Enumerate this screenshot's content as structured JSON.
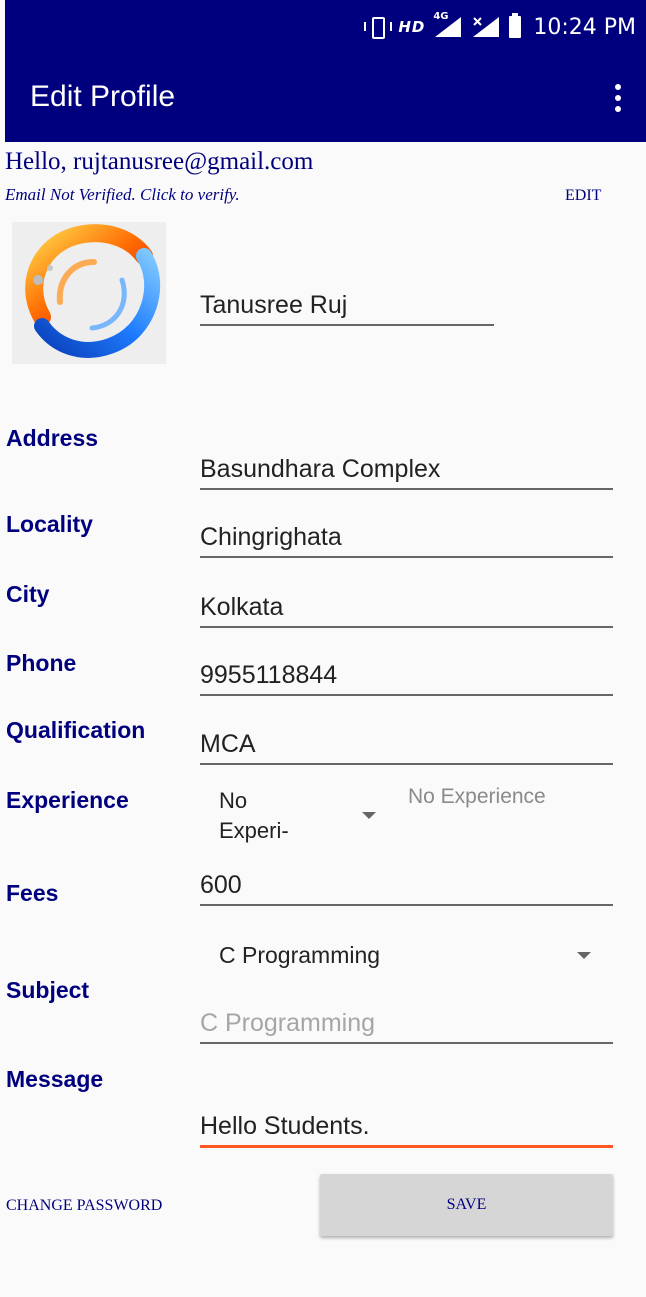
{
  "status_bar": {
    "network_type": "HD",
    "network_gen": "4G",
    "time": "10:24 PM"
  },
  "app_bar": {
    "title": "Edit Profile",
    "menu_icon": "overflow-menu-icon"
  },
  "account": {
    "greeting": "Hello, rujtanusree@gmail.com",
    "verify_text": "Email Not Verified. Click to verify.",
    "edit_label": "EDIT"
  },
  "profile": {
    "name": "Tanusree Ruj",
    "avatar_icon": "fire-water-ring-image"
  },
  "fields": {
    "address": {
      "label": "Address",
      "value": "Basundhara Complex"
    },
    "locality": {
      "label": "Locality",
      "value": "Chingrighata"
    },
    "city": {
      "label": "City",
      "value": "Kolkata"
    },
    "phone": {
      "label": "Phone",
      "value": "9955118844"
    },
    "qualification": {
      "label": "Qualification",
      "value": "MCA"
    },
    "experience": {
      "label": "Experience",
      "selected_line1": "No",
      "selected_line2": "Experi-",
      "hint": "No Experience"
    },
    "fees": {
      "label": "Fees",
      "value": "600"
    },
    "subject": {
      "label": "Subject",
      "selected": "C Programming",
      "hint": "C Programming"
    },
    "message": {
      "label": "Message",
      "value": "Hello Students."
    }
  },
  "actions": {
    "change_password": "CHANGE PASSWORD",
    "save": "SAVE"
  },
  "colors": {
    "primary": "#00007f",
    "accent": "#ff5722",
    "background": "#fafafa",
    "button": "#d6d6d6"
  }
}
